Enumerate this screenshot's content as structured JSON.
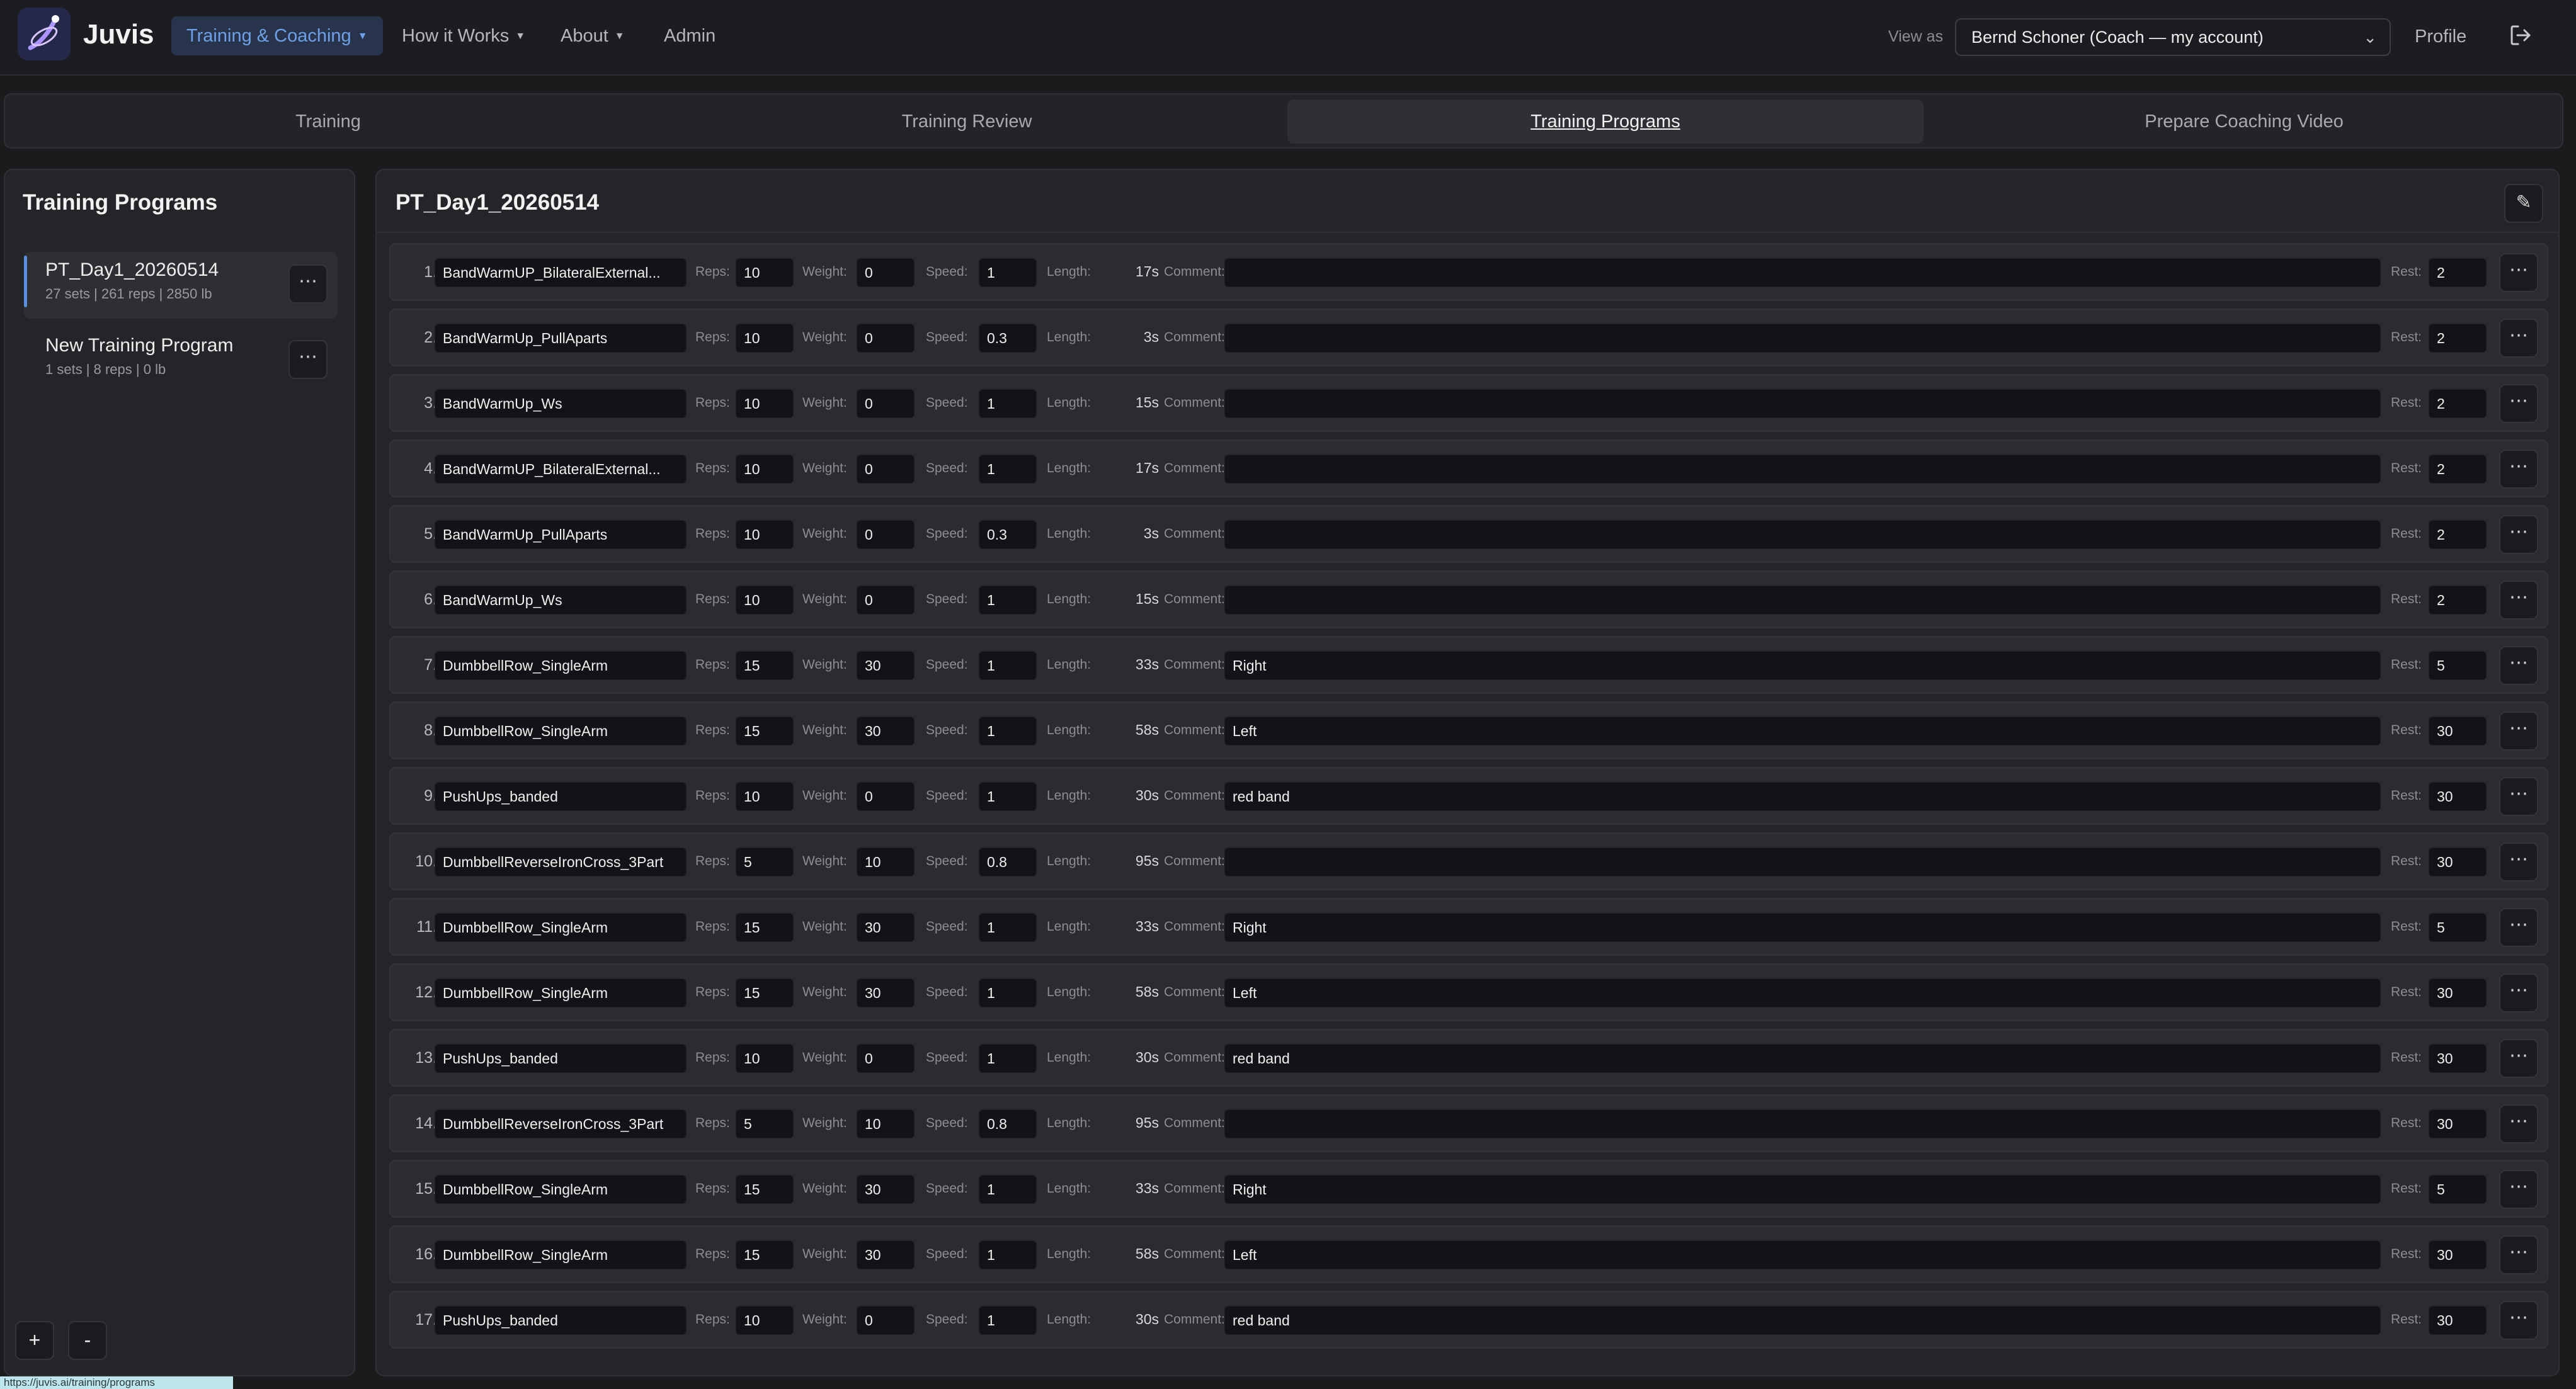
{
  "app": {
    "brand": "Juvis",
    "nav": [
      {
        "label": "Training & Coaching",
        "has_caret": true,
        "active": true
      },
      {
        "label": "How it Works",
        "has_caret": true,
        "active": false
      },
      {
        "label": "About",
        "has_caret": true,
        "active": false
      },
      {
        "label": "Admin",
        "has_caret": false,
        "active": false
      }
    ],
    "view_as_label": "View as",
    "view_as_value": "Bernd Schoner (Coach — my account)",
    "profile_label": "Profile",
    "accent_color": "#5a8fe0"
  },
  "tabs": [
    {
      "label": "Training",
      "active": false
    },
    {
      "label": "Training Review",
      "active": false
    },
    {
      "label": "Training Programs",
      "active": true
    },
    {
      "label": "Prepare Coaching Video",
      "active": false
    }
  ],
  "left_panel": {
    "title": "Training Programs",
    "programs": [
      {
        "name": "PT_Day1_20260514",
        "meta": "27 sets | 261 reps | 2850 lb",
        "selected": true
      },
      {
        "name": "New Training Program",
        "meta": "1 sets | 8 reps | 0 lb",
        "selected": false
      }
    ],
    "add_label": "+",
    "remove_label": "-",
    "status_url": "https://juvis.ai/training/programs"
  },
  "main": {
    "title": "PT_Day1_20260514",
    "labels": {
      "reps": "Reps:",
      "weight": "Weight:",
      "speed": "Speed:",
      "length": "Length:",
      "comment": "Comment:",
      "rest": "Rest:"
    },
    "exercises": [
      {
        "index": "1.",
        "name": "BandWarmUP_BilateralExternal...",
        "reps": "10",
        "weight": "0",
        "speed": "1",
        "length": "17s",
        "comment": "",
        "rest": "2"
      },
      {
        "index": "2.",
        "name": "BandWarmUp_PullAparts",
        "reps": "10",
        "weight": "0",
        "speed": "0.3",
        "length": "3s",
        "comment": "",
        "rest": "2"
      },
      {
        "index": "3.",
        "name": "BandWarmUp_Ws",
        "reps": "10",
        "weight": "0",
        "speed": "1",
        "length": "15s",
        "comment": "",
        "rest": "2"
      },
      {
        "index": "4.",
        "name": "BandWarmUP_BilateralExternal...",
        "reps": "10",
        "weight": "0",
        "speed": "1",
        "length": "17s",
        "comment": "",
        "rest": "2"
      },
      {
        "index": "5.",
        "name": "BandWarmUp_PullAparts",
        "reps": "10",
        "weight": "0",
        "speed": "0.3",
        "length": "3s",
        "comment": "",
        "rest": "2"
      },
      {
        "index": "6.",
        "name": "BandWarmUp_Ws",
        "reps": "10",
        "weight": "0",
        "speed": "1",
        "length": "15s",
        "comment": "",
        "rest": "2"
      },
      {
        "index": "7.",
        "name": "DumbbellRow_SingleArm",
        "reps": "15",
        "weight": "30",
        "speed": "1",
        "length": "33s",
        "comment": "Right",
        "rest": "5"
      },
      {
        "index": "8.",
        "name": "DumbbellRow_SingleArm",
        "reps": "15",
        "weight": "30",
        "speed": "1",
        "length": "58s",
        "comment": "Left",
        "rest": "30"
      },
      {
        "index": "9.",
        "name": "PushUps_banded",
        "reps": "10",
        "weight": "0",
        "speed": "1",
        "length": "30s",
        "comment": "red band",
        "rest": "30"
      },
      {
        "index": "10.",
        "name": "DumbbellReverseIronCross_3Part",
        "reps": "5",
        "weight": "10",
        "speed": "0.8",
        "length": "95s",
        "comment": "",
        "rest": "30"
      },
      {
        "index": "11.",
        "name": "DumbbellRow_SingleArm",
        "reps": "15",
        "weight": "30",
        "speed": "1",
        "length": "33s",
        "comment": "Right",
        "rest": "5"
      },
      {
        "index": "12.",
        "name": "DumbbellRow_SingleArm",
        "reps": "15",
        "weight": "30",
        "speed": "1",
        "length": "58s",
        "comment": "Left",
        "rest": "30"
      },
      {
        "index": "13.",
        "name": "PushUps_banded",
        "reps": "10",
        "weight": "0",
        "speed": "1",
        "length": "30s",
        "comment": "red band",
        "rest": "30"
      },
      {
        "index": "14.",
        "name": "DumbbellReverseIronCross_3Part",
        "reps": "5",
        "weight": "10",
        "speed": "0.8",
        "length": "95s",
        "comment": "",
        "rest": "30"
      },
      {
        "index": "15.",
        "name": "DumbbellRow_SingleArm",
        "reps": "15",
        "weight": "30",
        "speed": "1",
        "length": "33s",
        "comment": "Right",
        "rest": "5"
      },
      {
        "index": "16.",
        "name": "DumbbellRow_SingleArm",
        "reps": "15",
        "weight": "30",
        "speed": "1",
        "length": "58s",
        "comment": "Left",
        "rest": "30"
      },
      {
        "index": "17.",
        "name": "PushUps_banded",
        "reps": "10",
        "weight": "0",
        "speed": "1",
        "length": "30s",
        "comment": "red band",
        "rest": "30"
      }
    ]
  }
}
